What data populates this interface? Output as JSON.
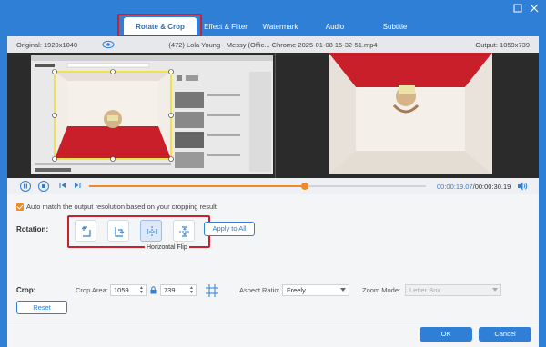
{
  "tabs": [
    {
      "label": "Rotate & Crop",
      "active": true
    },
    {
      "label": "Effect & Filter",
      "active": false
    },
    {
      "label": "Watermark",
      "active": false
    },
    {
      "label": "Audio",
      "active": false
    },
    {
      "label": "Subtitle",
      "active": false
    }
  ],
  "window": {
    "maximize_icon": "maximize-icon",
    "close_icon": "close-icon"
  },
  "info_bar": {
    "original": "Original: 1920x1040",
    "filename": "(472) Lola Young - Messy (Offic... Chrome 2025-01-08 15-32-51.mp4",
    "output": "Output: 1059x739"
  },
  "playback": {
    "progress": 0.64,
    "current_time": "00:00:19.07",
    "total_time": "/00:00:30.19"
  },
  "settings": {
    "auto_match_label": "Auto match the output resolution based on your cropping result",
    "auto_match_checked": true,
    "rotation_label": "Rotation:",
    "rotation_buttons": [
      {
        "icon": "rotate-left-icon"
      },
      {
        "icon": "rotate-right-icon"
      },
      {
        "icon": "flip-horizontal-icon",
        "selected": true
      },
      {
        "icon": "flip-vertical-icon"
      }
    ],
    "apply_all_label": "Apply to All",
    "tooltip": "Horizontal Flip",
    "crop_label": "Crop:",
    "crop_area_label": "Crop Area:",
    "crop_width": "1059",
    "crop_height": "739",
    "aspect_label": "Aspect Ratio:",
    "aspect_value": "Freely",
    "zoom_label": "Zoom Mode:",
    "zoom_value": "Letter Box",
    "reset_label": "Reset"
  },
  "footer": {
    "ok_label": "OK",
    "cancel_label": "Cancel"
  },
  "colors": {
    "accent": "#2f7fd6",
    "highlight": "#c8202c",
    "progress": "#f08a24"
  }
}
